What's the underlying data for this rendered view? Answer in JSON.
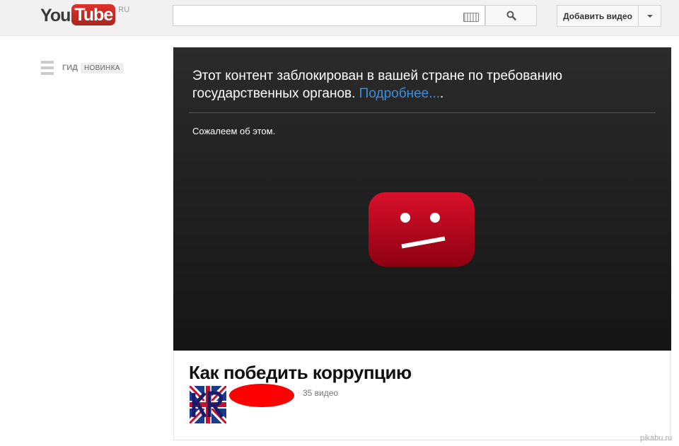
{
  "header": {
    "logo_you": "You",
    "logo_tube": "Tube",
    "logo_region": "RU",
    "search_placeholder": "",
    "upload_label": "Добавить видео"
  },
  "guide": {
    "label": "ГИД",
    "badge": "НОВИНКА"
  },
  "player": {
    "message": "Этот контент заблокирован в вашей стране по требованию государственных органов.",
    "link": "Подробнее...",
    "link_suffix": ".",
    "sorry": "Сожалеем об этом."
  },
  "video": {
    "title": "Как победить коррупцию",
    "channel_separator": "·",
    "video_count": "35 видео"
  },
  "watermark": "pikabu.ru",
  "colors": {
    "brand_red": "#cc0000",
    "link_blue": "#3e8ed8",
    "player_bg": "#202020"
  }
}
